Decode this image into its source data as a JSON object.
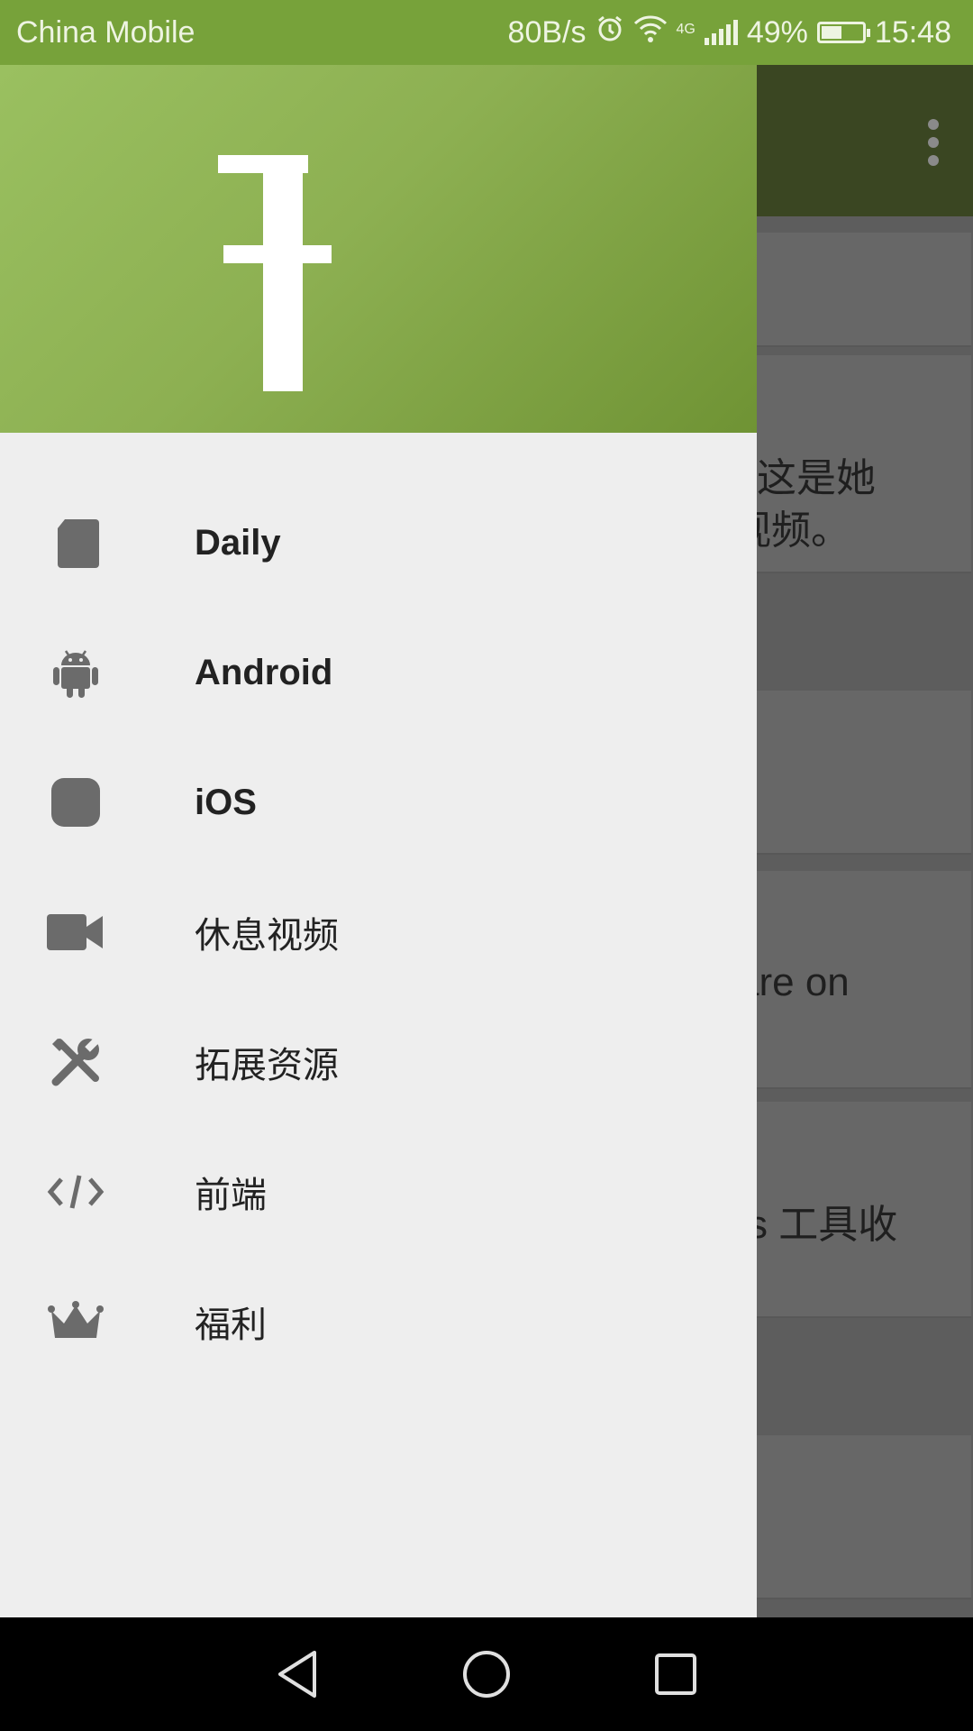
{
  "status_bar": {
    "carrier": "China Mobile",
    "speed": "80B/s",
    "network": "4G",
    "battery": "49%",
    "time": "15:48"
  },
  "background_app": {
    "snippets": [
      "这是她",
      "视频。",
      "are on",
      "Js 工具收"
    ]
  },
  "drawer": {
    "menu_items": [
      {
        "label": "Daily",
        "icon": "daily-icon"
      },
      {
        "label": "Android",
        "icon": "android-icon"
      },
      {
        "label": "iOS",
        "icon": "ios-icon"
      },
      {
        "label": "休息视频",
        "icon": "video-camera-icon"
      },
      {
        "label": "拓展资源",
        "icon": "tools-icon"
      },
      {
        "label": "前端",
        "icon": "code-icon"
      },
      {
        "label": "福利",
        "icon": "crown-icon"
      }
    ]
  },
  "colors": {
    "status_bar": "#77a23a",
    "header_start": "#9ac060",
    "header_end": "#6f9334",
    "drawer_bg": "#eeeeee",
    "icon_gray": "#6b6b6b"
  }
}
